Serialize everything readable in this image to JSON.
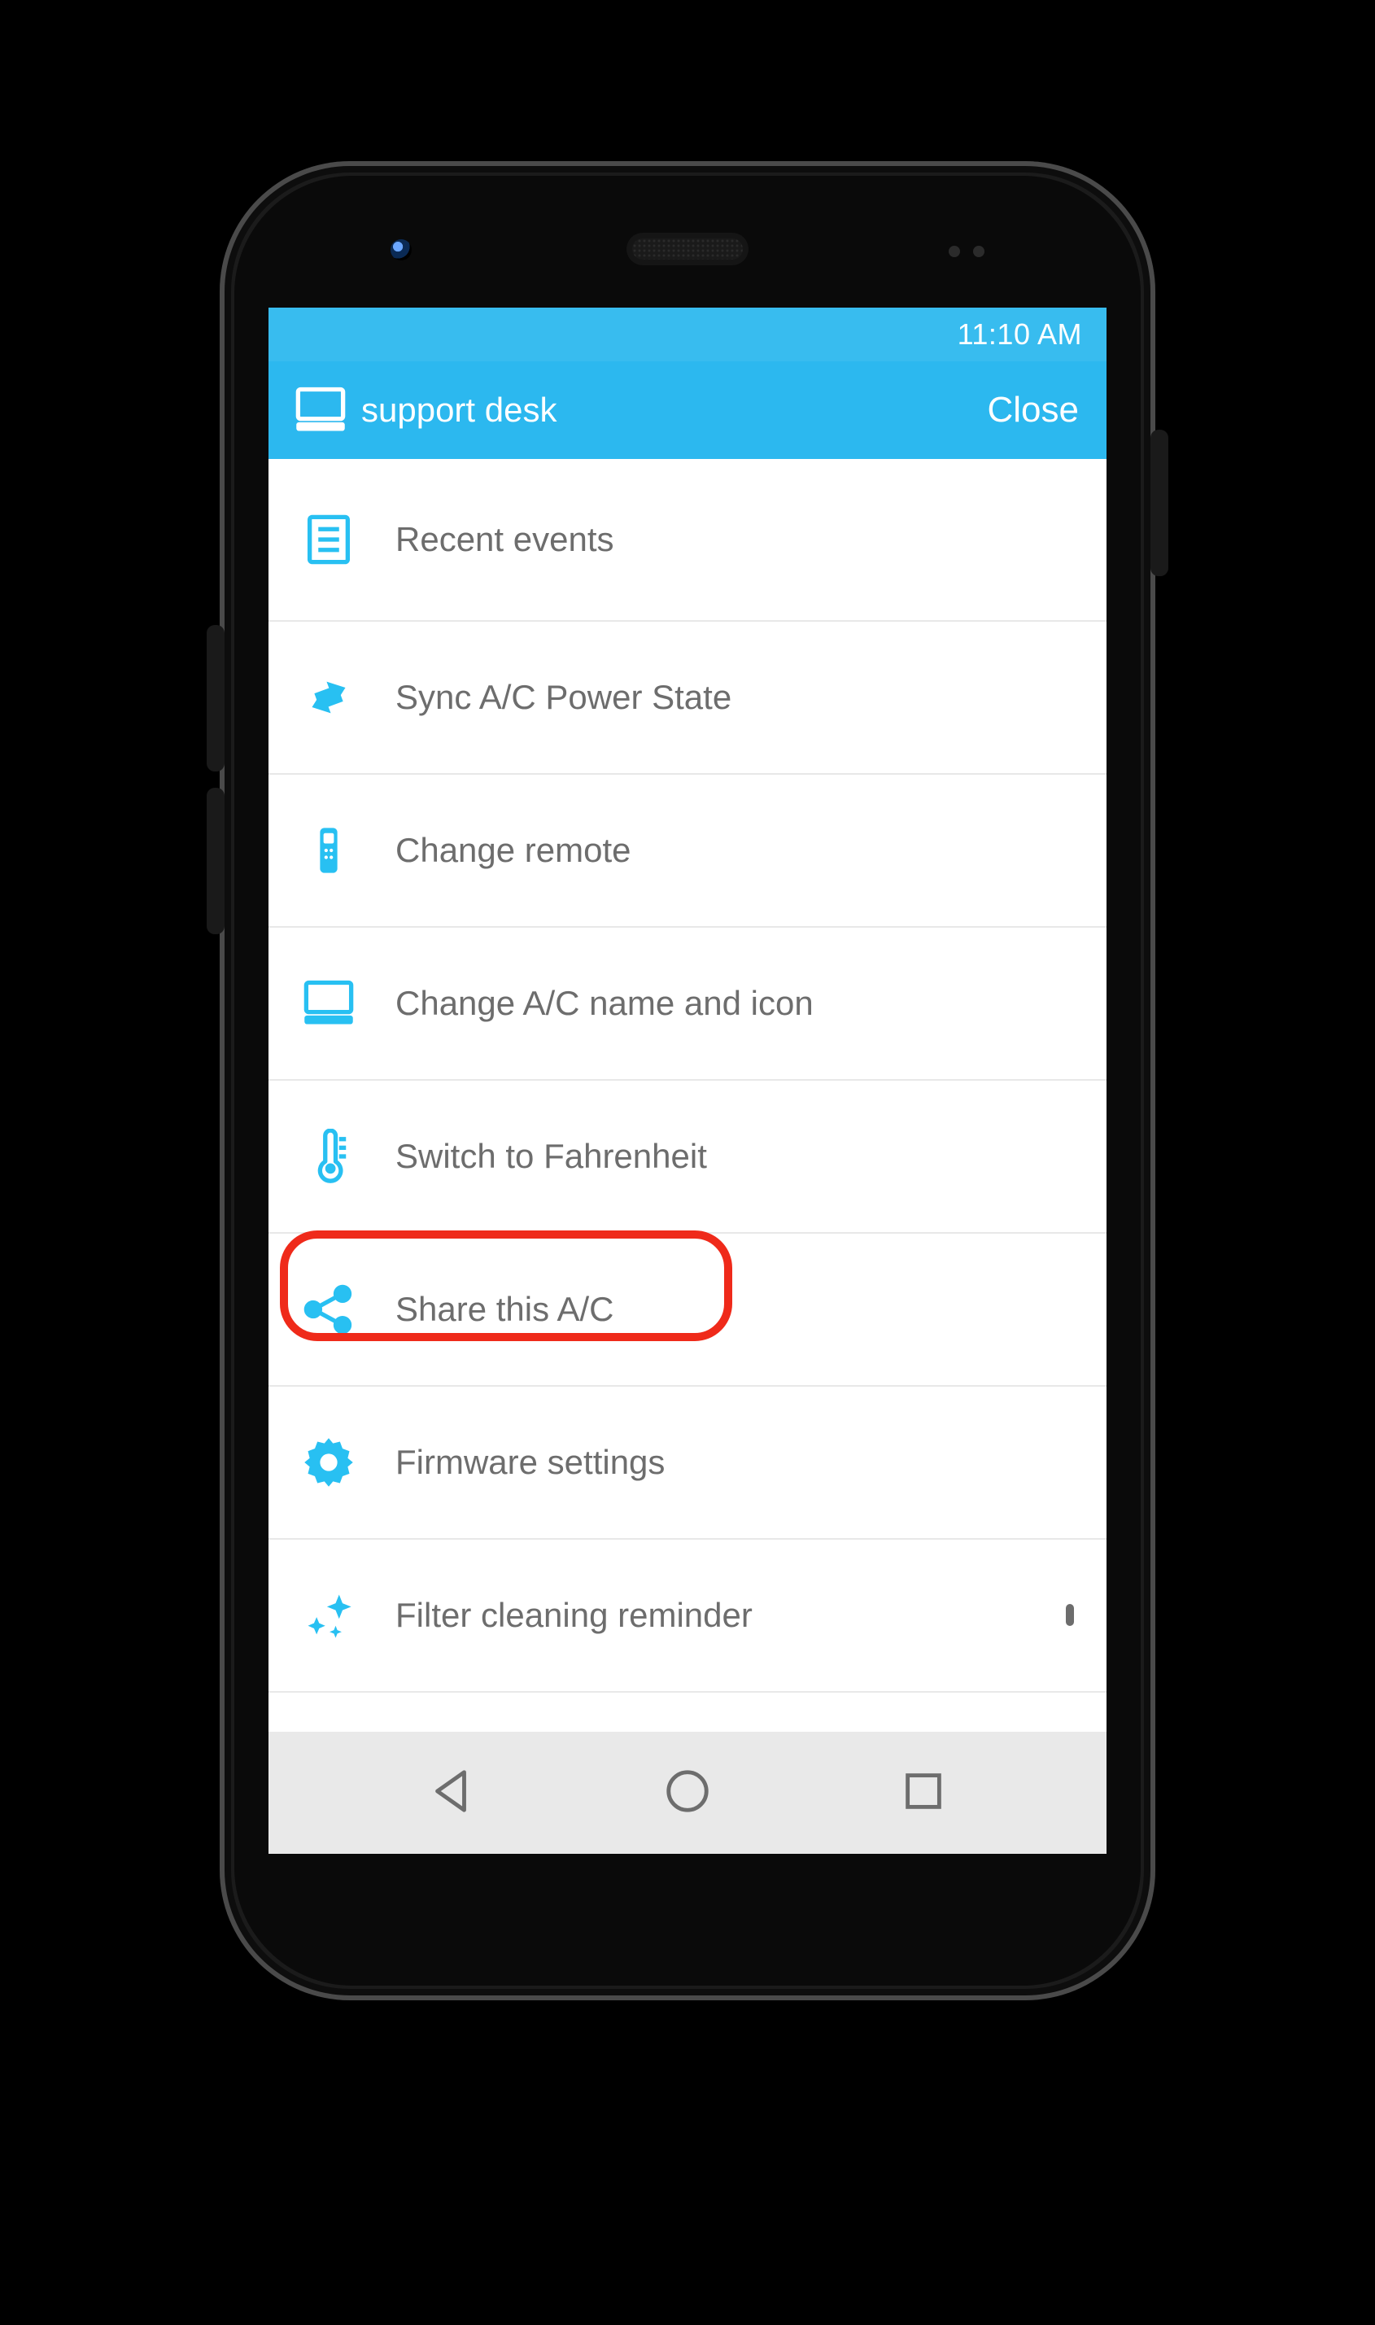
{
  "statusbar": {
    "time": "11:10 AM"
  },
  "appbar": {
    "icon": "desktop-icon",
    "title": "support desk",
    "close_label": "Close"
  },
  "menu": {
    "items": [
      {
        "icon": "list-icon",
        "label": "Recent events"
      },
      {
        "icon": "sync-icon",
        "label": "Sync A/C Power State"
      },
      {
        "icon": "remote-icon",
        "label": "Change remote"
      },
      {
        "icon": "desktop-icon",
        "label": "Change A/C name and icon"
      },
      {
        "icon": "thermometer-icon",
        "label": "Switch to Fahrenheit"
      },
      {
        "icon": "share-icon",
        "label": "Share this A/C",
        "highlighted": true
      },
      {
        "icon": "gear-icon",
        "label": "Firmware settings"
      },
      {
        "icon": "sparkle-icon",
        "label": "Filter cleaning reminder",
        "checkbox": true,
        "checked": false
      }
    ]
  },
  "colors": {
    "accent": "#28c0f2",
    "text_muted": "#6d6d6d",
    "highlight_border": "#ef2a1a"
  }
}
